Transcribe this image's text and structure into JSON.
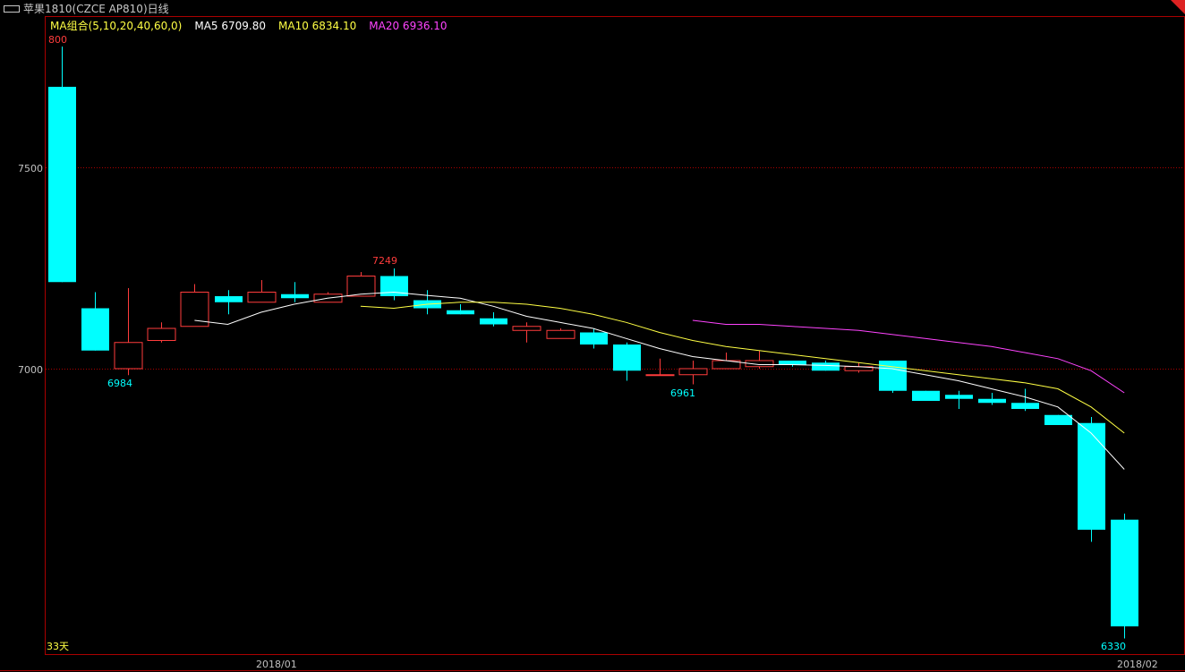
{
  "window": {
    "title": "苹果1810(CZCE AP810)日线",
    "title_icon": "window-icon",
    "close_icon": "close-icon",
    "close_color": "#dd2222"
  },
  "legend": {
    "group": "MA组合(5,10,20,40,60,0)",
    "ma5": "MA5 6709.80",
    "ma10": "MA10 6834.10",
    "ma20": "MA20 6936.10"
  },
  "colors": {
    "up": "#ff3c3c",
    "down": "#00ffff",
    "ma5": "#ffffff",
    "ma10": "#ffff44",
    "ma20": "#ff44ff",
    "frame": "#aa0000",
    "grid": "#aa0000"
  },
  "footer": {
    "count": "33天"
  },
  "chart_data": {
    "type": "candlestick",
    "y_ticks": [
      7500,
      7000
    ],
    "y_ticks_labels": [
      "7500",
      "7000"
    ],
    "ylim": [
      6330,
      7800
    ],
    "x_labels": [
      "2018/01",
      "2018/02"
    ],
    "grid": "horizontal dotted",
    "annotations": {
      "high_partial": "800",
      "high": "7249",
      "low1": "6984",
      "low2": "6961",
      "last_low": "6330"
    },
    "candles": [
      {
        "o": 7700,
        "h": 7800,
        "l": 7215,
        "c": 7215
      },
      {
        "o": 7150,
        "h": 7190,
        "l": 7045,
        "c": 7045
      },
      {
        "o": 7000,
        "h": 7200,
        "l": 6984,
        "c": 7065
      },
      {
        "o": 7070,
        "h": 7115,
        "l": 7065,
        "c": 7100
      },
      {
        "o": 7105,
        "h": 7210,
        "l": 7105,
        "c": 7190
      },
      {
        "o": 7180,
        "h": 7195,
        "l": 7135,
        "c": 7165
      },
      {
        "o": 7165,
        "h": 7220,
        "l": 7165,
        "c": 7190
      },
      {
        "o": 7185,
        "h": 7215,
        "l": 7165,
        "c": 7175
      },
      {
        "o": 7165,
        "h": 7190,
        "l": 7165,
        "c": 7185
      },
      {
        "o": 7180,
        "h": 7240,
        "l": 7180,
        "c": 7230
      },
      {
        "o": 7230,
        "h": 7249,
        "l": 7170,
        "c": 7180
      },
      {
        "o": 7170,
        "h": 7195,
        "l": 7135,
        "c": 7150
      },
      {
        "o": 7145,
        "h": 7160,
        "l": 7135,
        "c": 7135
      },
      {
        "o": 7125,
        "h": 7140,
        "l": 7105,
        "c": 7110
      },
      {
        "o": 7095,
        "h": 7115,
        "l": 7065,
        "c": 7105
      },
      {
        "o": 7075,
        "h": 7100,
        "l": 7075,
        "c": 7095
      },
      {
        "o": 7090,
        "h": 7100,
        "l": 7050,
        "c": 7060
      },
      {
        "o": 7060,
        "h": 7065,
        "l": 6970,
        "c": 6995
      },
      {
        "o": 6985,
        "h": 7025,
        "l": 6985,
        "c": 6985
      },
      {
        "o": 6985,
        "h": 7020,
        "l": 6961,
        "c": 7000
      },
      {
        "o": 7000,
        "h": 7040,
        "l": 7000,
        "c": 7020
      },
      {
        "o": 7005,
        "h": 7045,
        "l": 7000,
        "c": 7020
      },
      {
        "o": 7020,
        "h": 7020,
        "l": 7005,
        "c": 7010
      },
      {
        "o": 7015,
        "h": 7020,
        "l": 6995,
        "c": 6995
      },
      {
        "o": 6995,
        "h": 7015,
        "l": 6990,
        "c": 7005
      },
      {
        "o": 7020,
        "h": 7020,
        "l": 6940,
        "c": 6945
      },
      {
        "o": 6945,
        "h": 6945,
        "l": 6920,
        "c": 6920
      },
      {
        "o": 6935,
        "h": 6945,
        "l": 6900,
        "c": 6925
      },
      {
        "o": 6925,
        "h": 6940,
        "l": 6910,
        "c": 6915
      },
      {
        "o": 6915,
        "h": 6950,
        "l": 6895,
        "c": 6900
      },
      {
        "o": 6885,
        "h": 6885,
        "l": 6865,
        "c": 6860
      },
      {
        "o": 6865,
        "h": 6880,
        "l": 6570,
        "c": 6600
      },
      {
        "o": 6625,
        "h": 6640,
        "l": 6330,
        "c": 6360
      }
    ],
    "ma5": [
      null,
      null,
      null,
      null,
      7120,
      7110,
      7140,
      7160,
      7175,
      7185,
      7190,
      7182,
      7175,
      7155,
      7130,
      7115,
      7100,
      7075,
      7050,
      7030,
      7020,
      7010,
      7010,
      7008,
      7005,
      7000,
      6985,
      6970,
      6950,
      6930,
      6905,
      6840,
      6750
    ],
    "ma10": [
      null,
      null,
      null,
      null,
      null,
      null,
      null,
      null,
      null,
      7155,
      7150,
      7160,
      7165,
      7165,
      7160,
      7150,
      7135,
      7115,
      7090,
      7070,
      7055,
      7045,
      7035,
      7025,
      7015,
      7005,
      6995,
      6985,
      6975,
      6965,
      6950,
      6905,
      6840
    ],
    "ma20": [
      null,
      null,
      null,
      null,
      null,
      null,
      null,
      null,
      null,
      null,
      null,
      null,
      null,
      null,
      null,
      null,
      null,
      null,
      null,
      7120,
      7110,
      7110,
      7105,
      7100,
      7095,
      7085,
      7075,
      7065,
      7055,
      7040,
      7025,
      6995,
      6940
    ]
  }
}
